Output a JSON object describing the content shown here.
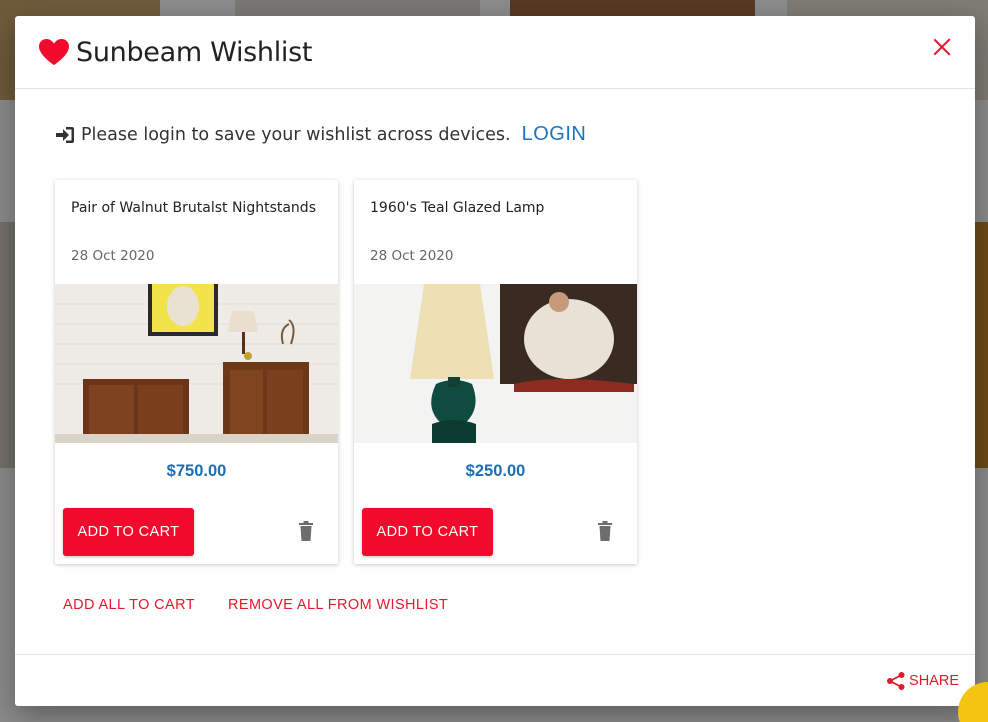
{
  "modal": {
    "title": "Sunbeam Wishlist",
    "login_message": "Please login to save your wishlist across devices.",
    "login_link": "LOGIN"
  },
  "items": [
    {
      "name": "Pair of Walnut Brutalst Nightstands",
      "date": "28 Oct 2020",
      "price": "$750.00",
      "add_label": "ADD TO CART"
    },
    {
      "name": "1960's Teal Glazed Lamp",
      "date": "28 Oct 2020",
      "price": "$250.00",
      "add_label": "ADD TO CART"
    }
  ],
  "actions": {
    "add_all": "ADD ALL TO CART",
    "remove_all": "REMOVE ALL FROM WISHLIST",
    "share": "SHARE"
  },
  "colors": {
    "accent_red": "#f10a2c",
    "price_blue": "#1a6fb5",
    "link_blue": "#1a73c2"
  },
  "icons": [
    "heart-icon",
    "close-icon",
    "login-icon",
    "trash-icon",
    "share-icon",
    "chat-icon"
  ]
}
